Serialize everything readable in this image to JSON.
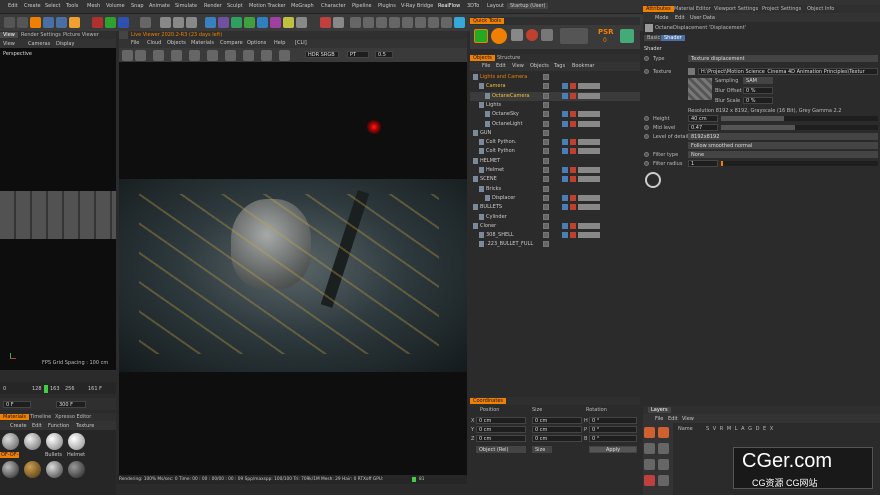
{
  "menubar": {
    "items": [
      "Edit",
      "Create",
      "Select",
      "Tools",
      "Mesh",
      "Volume",
      "Snap",
      "Animate",
      "Simulate",
      "Render",
      "Sculpt",
      "Motion Tracker",
      "MoGraph",
      "Character",
      "Pipeline",
      "Plugins",
      "V-Ray Bridge",
      "RealFlow",
      "3DTo",
      "Layout",
      "Startup (User)"
    ]
  },
  "viewport_left": {
    "tabs": [
      "View",
      "Render Settings",
      "Picture Viewer"
    ],
    "menu": [
      "View",
      "Cameras",
      "Display"
    ],
    "label": "Perspective",
    "grid_info": "FPS Grid Spacing : 100 cm",
    "timeline_nums": [
      "0",
      "128",
      "163",
      "256",
      "161 F"
    ],
    "frame_start": "0 F",
    "frame_end": "300 F"
  },
  "materials": {
    "tabs": [
      "Materials",
      "Timeline",
      "Xpresso Editor"
    ],
    "menu": [
      "Create",
      "Edit",
      "Function",
      "Texture"
    ],
    "items": [
      "OF-OF-",
      "Bullets",
      "Helmet",
      "",
      "",
      ""
    ]
  },
  "live_viewer": {
    "title": "Live Viewer 2020.2-R3 (23 days left)",
    "menu": [
      "File",
      "Cloud",
      "Objects",
      "Materials",
      "Compare",
      "Options",
      "Help",
      "[CLI]"
    ],
    "color_mode": "HDR SRGB",
    "pt": "PT",
    "zoom": "0.5"
  },
  "status_bar": {
    "text": "Rendering: 100%  Ms/sec: 0   Time: 00 : 00 : 00/00 : 00 : 09   Spp/maxspp: 100/100   Tri: 709k/1M   Mesh: 29   Hair: 0   RTXoff   GPU:",
    "gpu": "81"
  },
  "quick_tools": {
    "tab": "Quick Tools",
    "psr_label": "PSR",
    "psr_value": "0"
  },
  "objects": {
    "tabs": [
      "Objects",
      "Structure"
    ],
    "menu": [
      "File",
      "Edit",
      "View",
      "Objects",
      "Tags",
      "Bookmar"
    ],
    "rows": [
      {
        "name": "Lights and Camera",
        "indent": 0,
        "color": "#f08000"
      },
      {
        "name": "Camera",
        "indent": 1,
        "color": "#f0c040"
      },
      {
        "name": "OctaneCamera",
        "indent": 2,
        "color": "#f0c040"
      },
      {
        "name": "Lights",
        "indent": 1,
        "color": "#ccc"
      },
      {
        "name": "OctaneSky",
        "indent": 2,
        "color": "#ccc"
      },
      {
        "name": "OctaneLight",
        "indent": 2,
        "color": "#ccc"
      },
      {
        "name": "GUN",
        "indent": 0,
        "color": "#ccc"
      },
      {
        "name": "Colt Python.",
        "indent": 1,
        "color": "#ccc"
      },
      {
        "name": "Colt Python",
        "indent": 1,
        "color": "#ccc"
      },
      {
        "name": "HELMET",
        "indent": 0,
        "color": "#ccc"
      },
      {
        "name": "Helmet",
        "indent": 1,
        "color": "#ccc"
      },
      {
        "name": "SCENE",
        "indent": 0,
        "color": "#ccc"
      },
      {
        "name": "Bricks",
        "indent": 1,
        "color": "#ccc"
      },
      {
        "name": "Displacer",
        "indent": 2,
        "color": "#ccc"
      },
      {
        "name": "BULLETS",
        "indent": 0,
        "color": "#ccc"
      },
      {
        "name": "Cylinder",
        "indent": 1,
        "color": "#ccc"
      },
      {
        "name": "Cloner",
        "indent": 0,
        "color": "#ccc"
      },
      {
        "name": "308_SHELL",
        "indent": 1,
        "color": "#ccc"
      },
      {
        "name": ".223_BULLET_FULL",
        "indent": 1,
        "color": "#ccc"
      }
    ]
  },
  "coordinates": {
    "tab": "Coordinates",
    "cols": [
      "Position",
      "Size",
      "Rotation"
    ],
    "rows": [
      {
        "axis": "X",
        "pos": "0 cm",
        "size": "0 cm",
        "rot_axis": "H",
        "rot": "0 °"
      },
      {
        "axis": "Y",
        "pos": "0 cm",
        "size": "0 cm",
        "rot_axis": "P",
        "rot": "0 °"
      },
      {
        "axis": "Z",
        "pos": "0 cm",
        "size": "0 cm",
        "rot_axis": "B",
        "rot": "0 °"
      }
    ],
    "mode": "Object (Rel)",
    "size_mode": "Size",
    "apply": "Apply"
  },
  "attributes": {
    "tabs": [
      "Attributes",
      "Material Editor",
      "Viewport Settings",
      "Project Settings",
      "Object Info"
    ],
    "menu": [
      "Mode",
      "Edit",
      "User Data"
    ],
    "shader_name": "OctaneDisplacement 'Displacement'",
    "subtabs": [
      "Basic",
      "Shader"
    ],
    "section": "Shader",
    "type_label": "Type",
    "type_value": "Texture displacement",
    "texture_label": "Texture",
    "texture_path": "H:\\Project\\Motion Science_Cinema 4D Animation Principles\\Textur",
    "sampling_label": "Sampling",
    "sampling_value": "SAM",
    "blur_offset_label": "Blur Offset",
    "blur_offset_value": "0 %",
    "blur_scale_label": "Blur Scale",
    "blur_scale_value": "0 %",
    "resolution": "Resolution 8192 x 8192, Grayscale (16 Bit), Grey Gamma 2.2",
    "height_label": "Height",
    "height_value": "40 cm",
    "mid_label": "Mid level",
    "mid_value": "0.47",
    "lod_label": "Level of detail",
    "lod_value": "8192x8192",
    "filter_smooth": "Follow smoothed normal",
    "filter_type_label": "Filter type",
    "filter_type_value": "None",
    "filter_radius_label": "Filter radius",
    "filter_radius_value": "1"
  },
  "layers": {
    "tab": "Layers",
    "menu": [
      "File",
      "Edit",
      "View"
    ],
    "col_name": "Name",
    "cols": "S V R M L A G D E X"
  },
  "watermark": {
    "title": "CGer.com",
    "sub": "CG资源 CG网站"
  },
  "colors": {
    "accent": "#f08000",
    "panel": "#2b2b2b",
    "dark": "#161616"
  }
}
